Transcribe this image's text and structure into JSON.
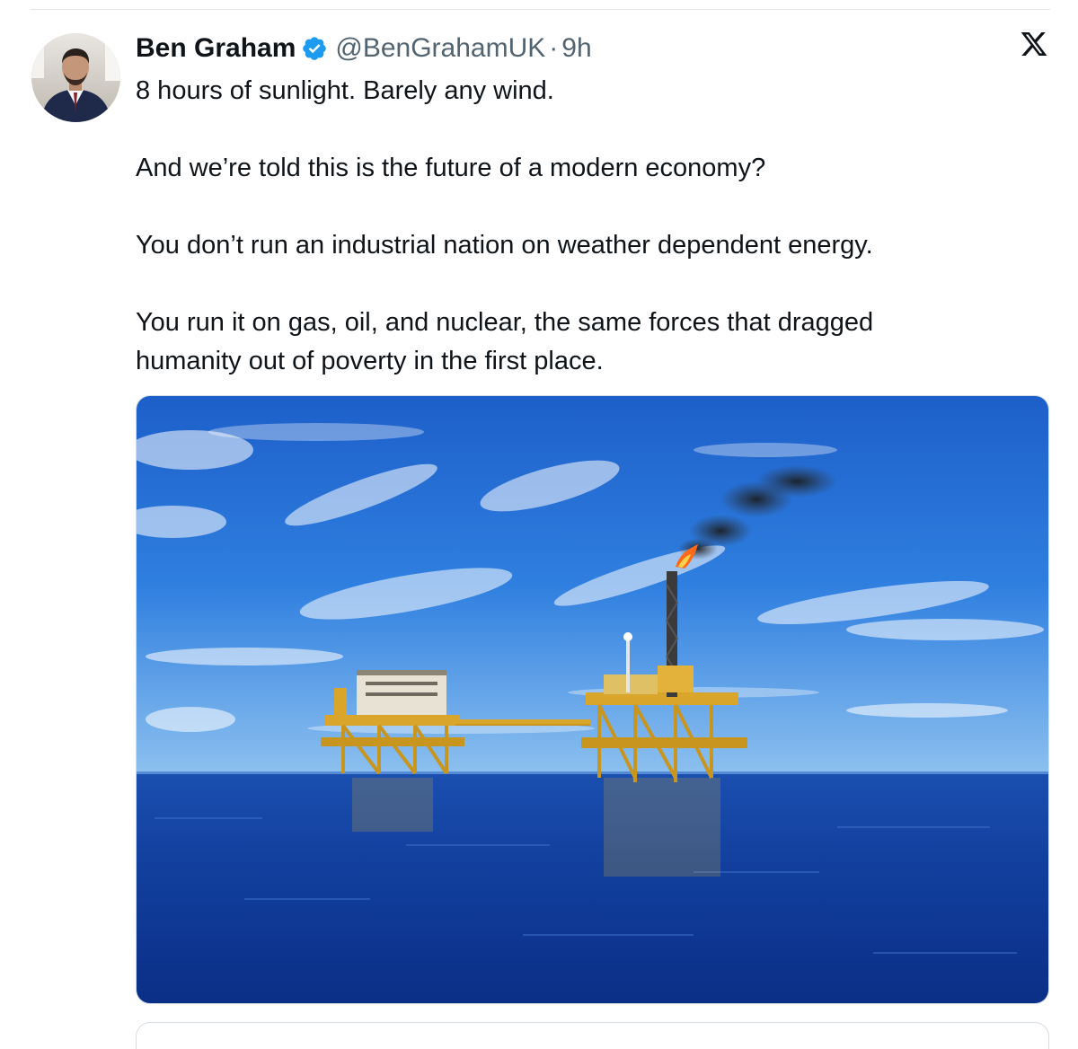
{
  "tweet": {
    "author": {
      "display_name": "Ben Graham",
      "handle": "@BenGrahamUK",
      "verified": true,
      "avatar_icon": "avatar"
    },
    "separator": "·",
    "timestamp": "9h",
    "text_lines": [
      "8 hours of sunlight. Barely any wind.",
      "And we’re told this is the future of a modern economy?",
      "You don’t run an industrial nation on weather dependent energy.",
      "You run it on gas, oil, and nuclear, the same forces that dragged",
      "humanity out of poverty in the first place."
    ],
    "media": {
      "icon": "offshore-oil-platform-photo"
    }
  },
  "platform": {
    "logo_icon": "x-logo-icon"
  },
  "colors": {
    "text_primary": "#0f1419",
    "text_secondary": "#536471",
    "verified_blue": "#1d9bf0",
    "divider": "#e1e6ea"
  }
}
